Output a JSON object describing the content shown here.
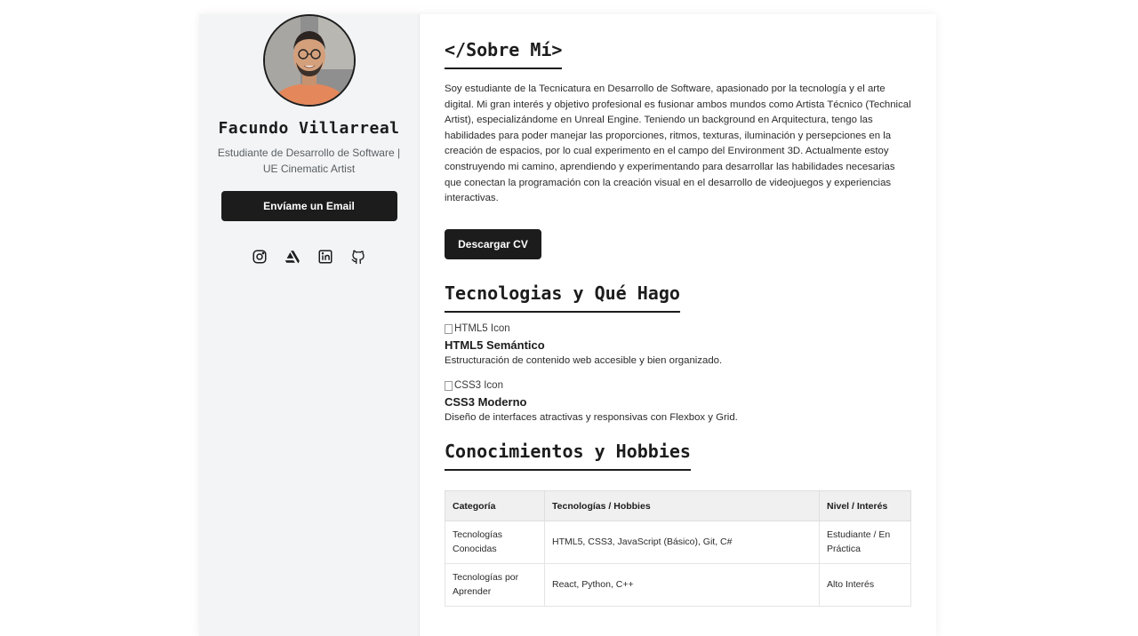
{
  "profile": {
    "name": "Facundo Villarreal",
    "role": "Estudiante de Desarrollo de Software | UE Cinematic Artist",
    "email_button": "Envíame un Email",
    "socials": [
      {
        "icon": "instagram-icon"
      },
      {
        "icon": "artstation-icon"
      },
      {
        "icon": "linkedin-icon"
      },
      {
        "icon": "github-icon"
      }
    ]
  },
  "about": {
    "title": "</Sobre Mí>",
    "text": "Soy estudiante de la Tecnicatura en Desarrollo de Software, apasionado por la tecnología y el arte digital. Mi gran interés y objetivo profesional es fusionar ambos mundos como Artista Técnico (Technical Artist), especializándome en Unreal Engine. Teniendo un background en Arquitectura, tengo las habilidades para poder manejar las proporciones, ritmos, texturas, iluminación y persepciones en la creación de espacios, por lo cual experimento en el campo del Environment 3D. Actualmente estoy construyendo mi camino, aprendiendo y experimentando para desarrollar las habilidades necesarias que conectan la programación con la creación visual en el desarrollo de videojuegos y experiencias interactivas.",
    "cv_button": "Descargar CV"
  },
  "tech": {
    "title": "Tecnologias y Qué Hago",
    "items": [
      {
        "img_alt": "HTML5 Icon",
        "name": "HTML5 Semántico",
        "desc": "Estructuración de contenido web accesible y bien organizado."
      },
      {
        "img_alt": "CSS3 Icon",
        "name": "CSS3 Moderno",
        "desc": "Diseño de interfaces atractivas y responsivas con Flexbox y Grid."
      }
    ]
  },
  "knowledge": {
    "title": "Conocimientos y Hobbies",
    "headers": [
      "Categoría",
      "Tecnologías / Hobbies",
      "Nivel / Interés"
    ],
    "rows": [
      [
        "Tecnologías Conocidas",
        "HTML5, CSS3, JavaScript (Básico), Git, C#",
        "Estudiante / En Práctica"
      ],
      [
        "Tecnologías por Aprender",
        "React, Python, C++",
        "Alto Interés"
      ]
    ]
  }
}
